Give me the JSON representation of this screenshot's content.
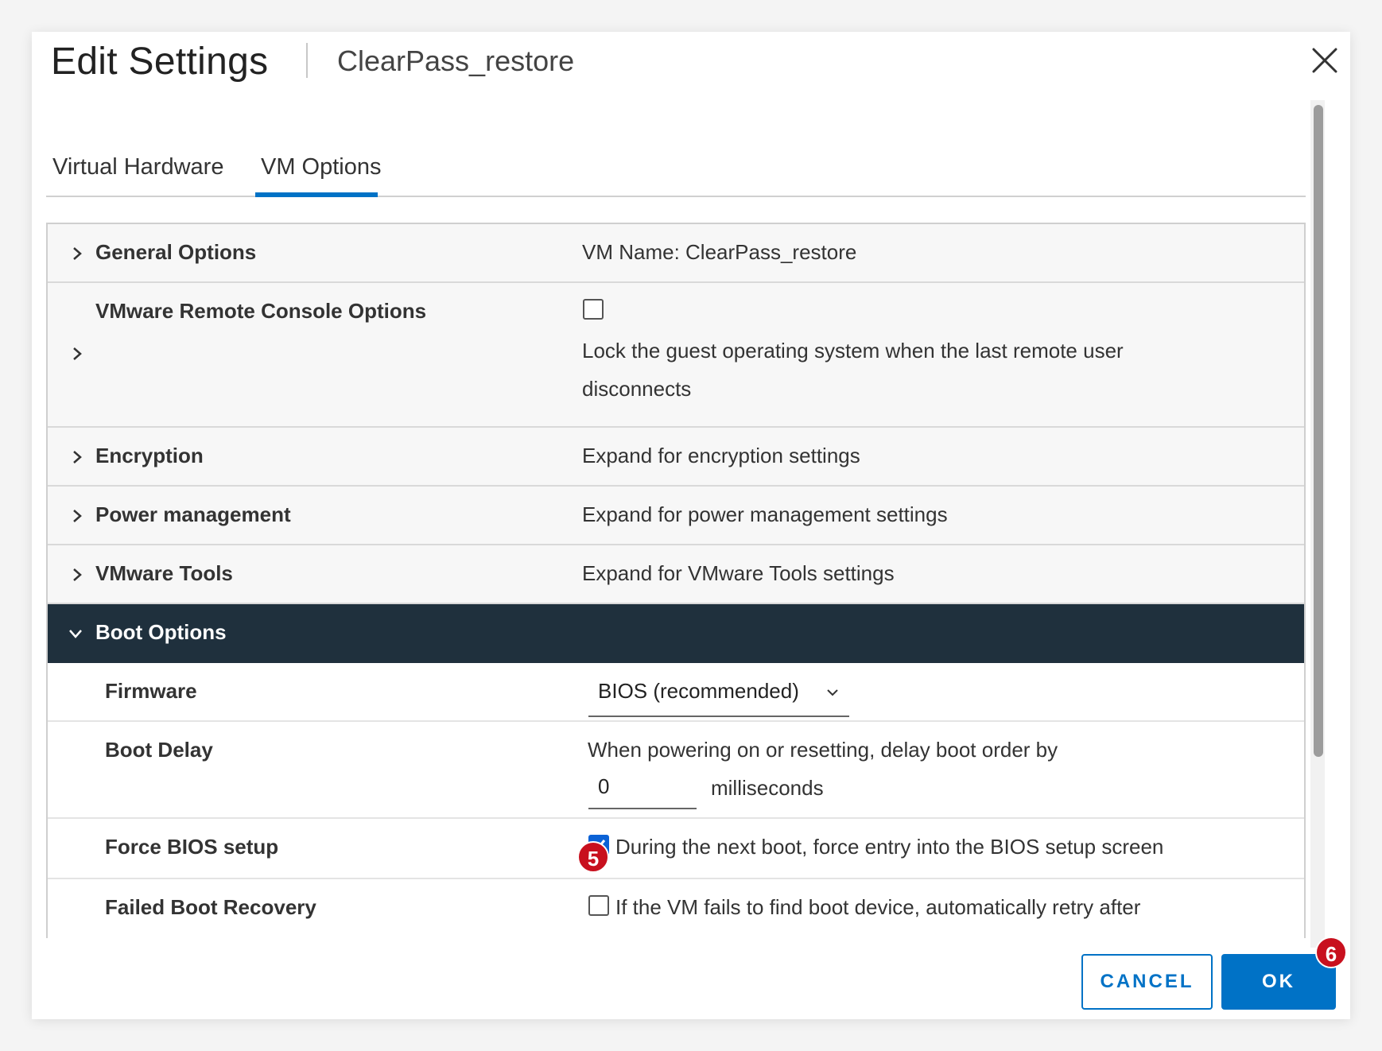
{
  "dialog": {
    "title": "Edit Settings",
    "subtitle": "ClearPass_restore"
  },
  "tabs": [
    {
      "label": "Virtual Hardware",
      "active": false
    },
    {
      "label": "VM Options",
      "active": true
    }
  ],
  "sections": {
    "general": {
      "label": "General Options",
      "value": "VM Name: ClearPass_restore"
    },
    "console": {
      "label": "VMware Remote Console Options",
      "checkbox_checked": false,
      "value_line1": "Lock the guest operating system when the last remote user",
      "value_line2": "disconnects"
    },
    "encryption": {
      "label": "Encryption",
      "value": "Expand for encryption settings"
    },
    "power": {
      "label": "Power management",
      "value": "Expand for power management settings"
    },
    "tools": {
      "label": "VMware Tools",
      "value": "Expand for VMware Tools settings"
    },
    "boot": {
      "label": "Boot Options"
    }
  },
  "boot": {
    "firmware": {
      "label": "Firmware",
      "selected": "BIOS (recommended)"
    },
    "delay": {
      "label": "Boot Delay",
      "text": "When powering on or resetting, delay boot order by",
      "value": "0",
      "unit": "milliseconds"
    },
    "force_bios": {
      "label": "Force BIOS setup",
      "checked": true,
      "text": "During the next boot, force entry into the BIOS setup screen"
    },
    "failed_recovery": {
      "label": "Failed Boot Recovery",
      "checked": false,
      "text": "If the VM fails to find boot device, automatically retry after"
    }
  },
  "badges": {
    "step5": "5",
    "step6": "6"
  },
  "buttons": {
    "cancel": "CANCEL",
    "ok": "OK"
  },
  "colors": {
    "accent": "#0072c6",
    "header_dark": "#1f303d",
    "badge": "#c8101e",
    "checkbox": "#0b62d6"
  }
}
